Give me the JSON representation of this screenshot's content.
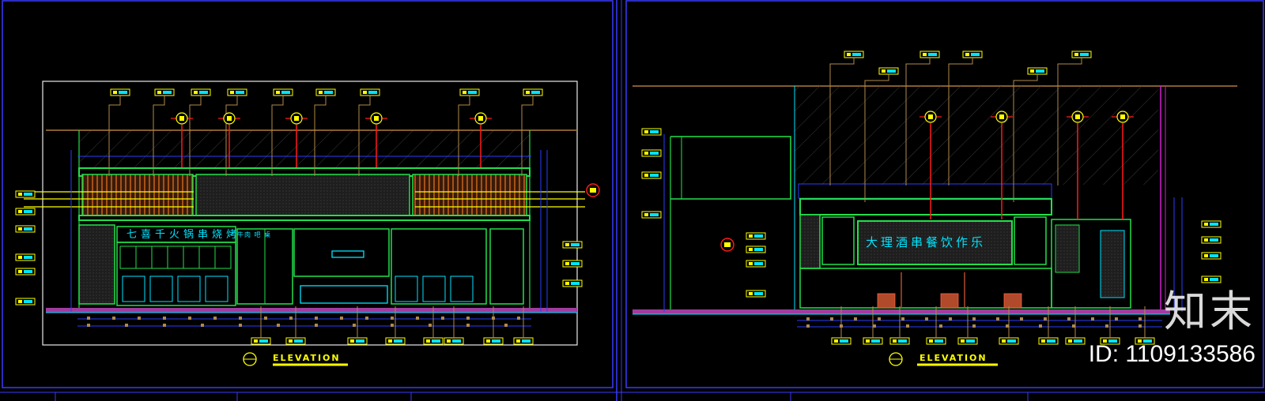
{
  "panels": [
    {
      "title": "ELEVATION",
      "sign_text": "七喜千火锅串烧烤",
      "sub_text": "牛肉 吧 桌"
    },
    {
      "title": "ELEVATION",
      "sign_text": "大理酒串餐饮作乐"
    }
  ],
  "watermark": {
    "logo": "知末",
    "id": "ID: 1109133586"
  },
  "colors": {
    "background": "#000000",
    "green": "#22e04a",
    "cyan": "#00e5ff",
    "blue": "#2a3cff",
    "yellow": "#ffff00",
    "red": "#ff1a1a",
    "brown": "#b08a4a",
    "orange": "#d2691e",
    "magenta": "#d020d0"
  }
}
